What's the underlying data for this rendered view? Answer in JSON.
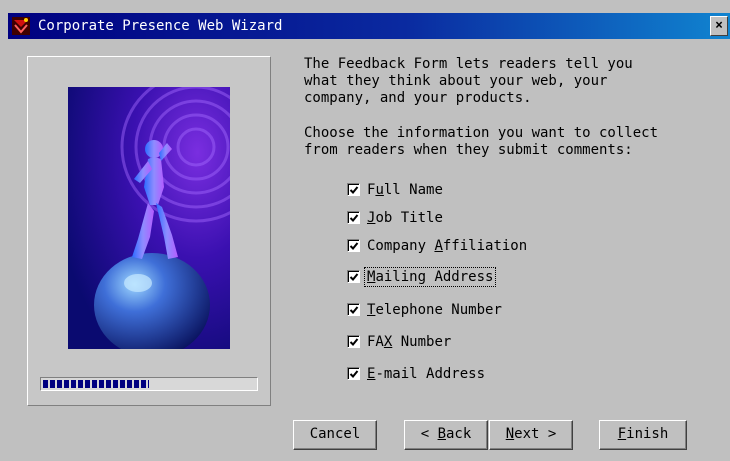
{
  "window": {
    "title": "Corporate Presence Web Wizard",
    "close_label": "×",
    "colors": {
      "titlebar": "#000080",
      "face": "#c0c0c0"
    }
  },
  "panel": {
    "image": "figure-standing-on-globe",
    "progress_percent": 50
  },
  "content": {
    "description": "The Feedback Form lets readers tell you\nwhat they think about your web, your\ncompany, and your products.",
    "instruction": "Choose the information you want to collect\nfrom readers when they submit comments:"
  },
  "fields": [
    {
      "pre": "F",
      "key": "u",
      "post": "ll Name",
      "checked": true,
      "focused": false
    },
    {
      "pre": "",
      "key": "J",
      "post": "ob Title",
      "checked": true,
      "focused": false
    },
    {
      "pre": "Company ",
      "key": "A",
      "post": "ffiliation",
      "checked": true,
      "focused": false
    },
    {
      "pre": "",
      "key": "M",
      "post": "ailing Address",
      "checked": true,
      "focused": true
    },
    {
      "pre": "",
      "key": "T",
      "post": "elephone Number",
      "checked": true,
      "focused": false
    },
    {
      "pre": "FA",
      "key": "X",
      "post": " Number",
      "checked": true,
      "focused": false
    },
    {
      "pre": "",
      "key": "E",
      "post": "-mail Address",
      "checked": true,
      "focused": false
    }
  ],
  "buttons": {
    "cancel": {
      "label": "Cancel"
    },
    "back": {
      "pre": "< ",
      "key": "B",
      "post": "ack"
    },
    "next": {
      "pre": "",
      "key": "N",
      "post": "ext >"
    },
    "finish": {
      "pre": "",
      "key": "F",
      "post": "inish"
    }
  }
}
